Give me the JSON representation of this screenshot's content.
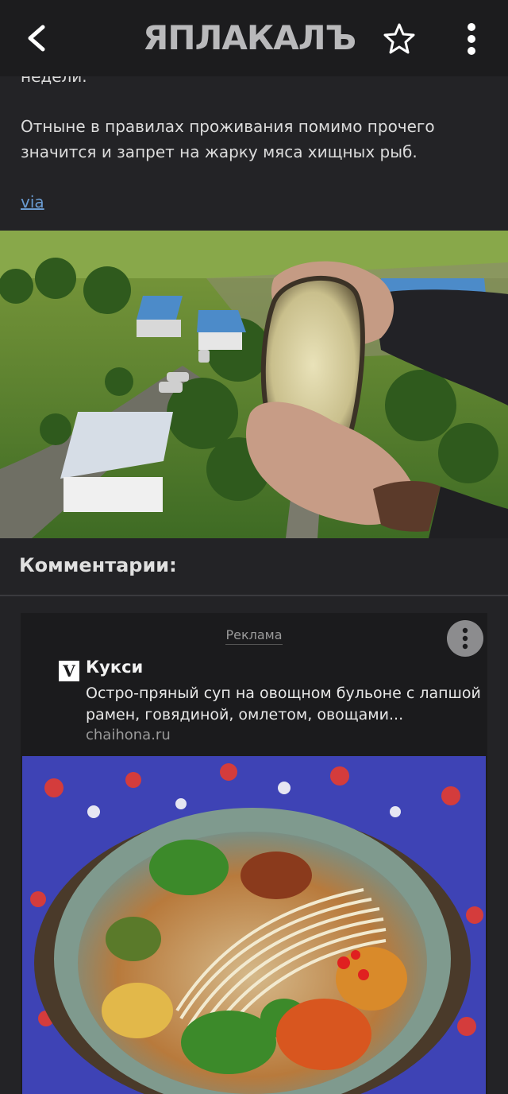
{
  "header": {
    "logo_text": "ЯПЛАКАЛЪ",
    "back_icon": "back-arrow-icon",
    "favorite_icon": "star-icon",
    "menu_icon": "more-vertical-icon"
  },
  "article": {
    "fragment": "недели.",
    "paragraph": "Отныне в правилах проживания помимо прочего значится и запрет на жарку мяса хищных рыб.",
    "via_link": "via"
  },
  "comments": {
    "title": "Комментарии:"
  },
  "ad": {
    "label": "Реклама",
    "logo_letter": "V",
    "title": "Кукси",
    "description": "Остро-пряный суп на овощном бульоне с лапшой рамен, говядиной, омлетом, овощами...",
    "domain": "chaihona.ru"
  },
  "colors": {
    "background": "#232326",
    "topbar": "#1c1c1e",
    "link": "#6a9bd1"
  }
}
